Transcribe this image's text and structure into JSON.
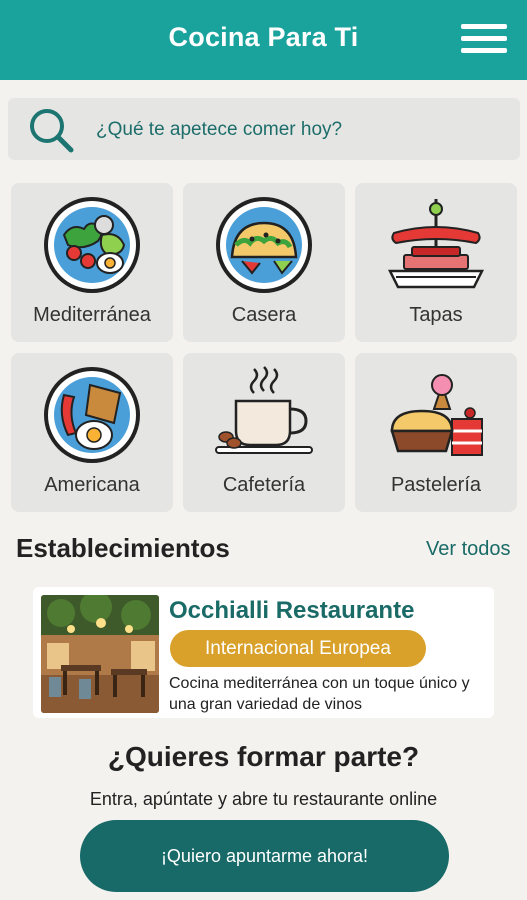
{
  "header": {
    "title": "Cocina Para Ti",
    "menu_icon": "hamburger-menu-icon"
  },
  "search": {
    "placeholder": "¿Qué te apetece comer hoy?",
    "icon": "search-icon"
  },
  "categories": [
    {
      "label": "Mediterránea",
      "icon": "salad-plate-icon"
    },
    {
      "label": "Casera",
      "icon": "taco-plate-icon"
    },
    {
      "label": "Tapas",
      "icon": "skewer-tapas-icon"
    },
    {
      "label": "Americana",
      "icon": "breakfast-plate-icon"
    },
    {
      "label": "Cafetería",
      "icon": "coffee-cup-icon"
    },
    {
      "label": "Pastelería",
      "icon": "pastry-cakes-icon"
    }
  ],
  "establishments": {
    "title": "Establecimientos",
    "see_all": "Ver todos",
    "items": [
      {
        "name": "Occhialli Restaurante",
        "badge": "Internacional Europea",
        "description": "Cocina mediterránea con un toque único y una gran variedad de vinos"
      }
    ]
  },
  "cta": {
    "title": "¿Quieres formar parte?",
    "subtitle": "Entra, apúntate y abre tu restaurante online",
    "button": "¡Quiero apuntarme ahora!"
  },
  "colors": {
    "primary": "#1aa39d",
    "dark_teal": "#176a67",
    "badge": "#d9a02a",
    "background": "#f4f2ee",
    "tile": "#e5e5e3"
  }
}
